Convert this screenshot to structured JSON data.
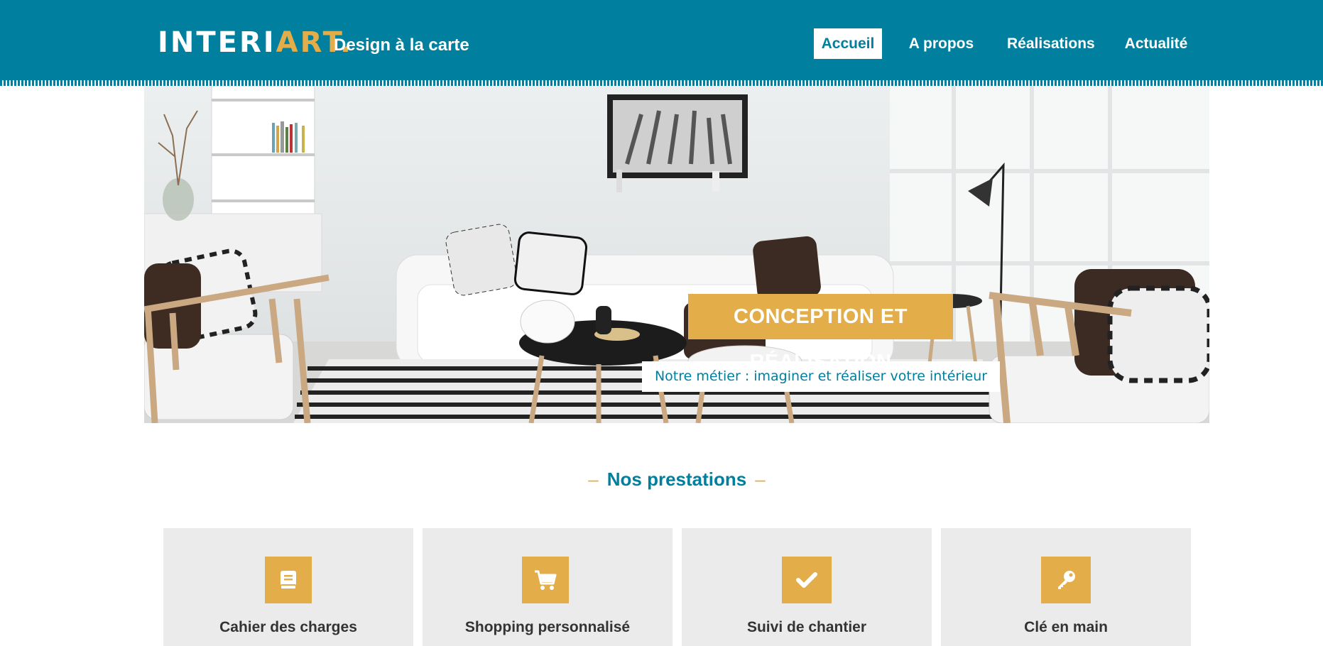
{
  "header": {
    "logo_inter": "INTERI",
    "logo_art": "ART.",
    "tagline": "Design à la carte",
    "nav": [
      {
        "label": "Accueil"
      },
      {
        "label": "A propos"
      },
      {
        "label": "Réalisations"
      },
      {
        "label": "Actualité"
      }
    ]
  },
  "hero": {
    "title": "CONCEPTION ET RÉALISATION",
    "subtitle": "Notre métier : imaginer et réaliser votre intérieur"
  },
  "section": {
    "title": "Nos prestations",
    "dash_left": "–",
    "dash_right": "–"
  },
  "services": [
    {
      "label": "Cahier des charges",
      "icon": "book-icon"
    },
    {
      "label": "Shopping personnalisé",
      "icon": "cart-icon"
    },
    {
      "label": "Suivi de chantier",
      "icon": "check-icon"
    },
    {
      "label": "Clé en main",
      "icon": "key-icon"
    }
  ],
  "colors": {
    "primary": "#00809e",
    "accent": "#e3ad49",
    "card_bg": "#ebebeb",
    "text_dark": "#333333"
  }
}
